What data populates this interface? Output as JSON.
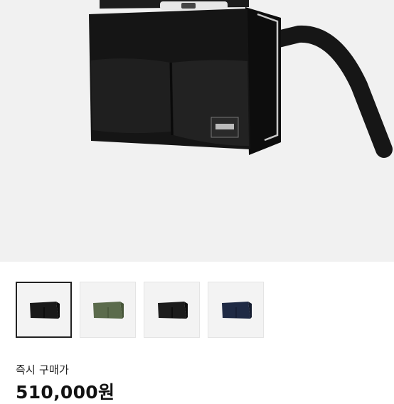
{
  "product": {
    "main_image": "black-shoulder-bag-photo",
    "thumbnails": [
      {
        "icon": "black-bag-thumbnail",
        "color": "#1a1a1a",
        "selected": true
      },
      {
        "icon": "olive-bag-thumbnail",
        "color": "#5b6b4c",
        "selected": false
      },
      {
        "icon": "black-bag-thumbnail",
        "color": "#1c1c1c",
        "selected": false
      },
      {
        "icon": "navy-bag-thumbnail",
        "color": "#1f2a44",
        "selected": false
      }
    ],
    "instant_buy_label": "즉시 구매가",
    "instant_buy_price": "510,000원"
  }
}
